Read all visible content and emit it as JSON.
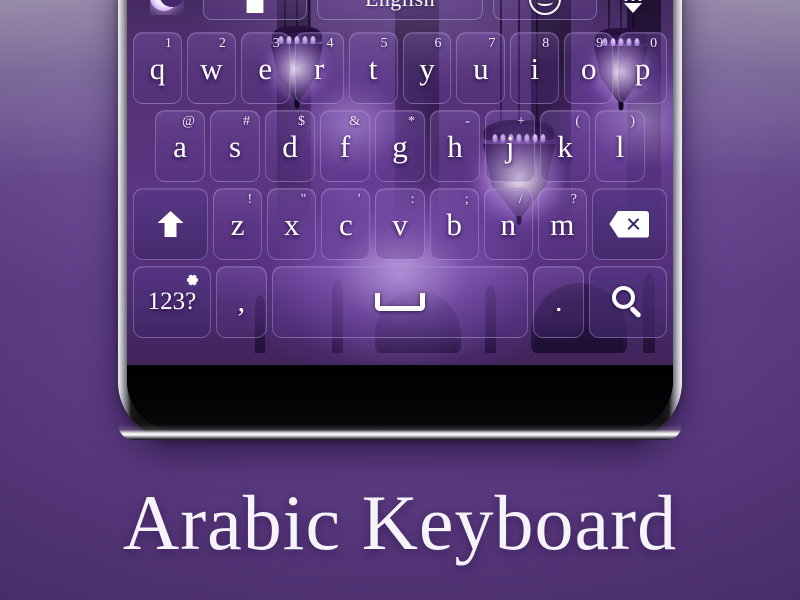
{
  "app": {
    "title": "Arabic Keyboard",
    "theme_colors": {
      "backdrop_purple": "#5e3d85",
      "keyboard_purple": "#563277",
      "key_fill": "#6a4a96",
      "key_border": "#c8b4ee",
      "label_white": "#ffffff",
      "glow_lavender": "#e2c4ff"
    }
  },
  "toolbar": {
    "moon_icon": "crescent-moon-icon",
    "theme_icon": "tshirt-icon",
    "language_label": "English",
    "emoji_icon": "smiley-face-icon",
    "keypad_icon": "keypad-dots-icon"
  },
  "keyboard": {
    "row1": [
      {
        "label": "q",
        "sup": "1"
      },
      {
        "label": "w",
        "sup": "2"
      },
      {
        "label": "e",
        "sup": "3"
      },
      {
        "label": "r",
        "sup": "4"
      },
      {
        "label": "t",
        "sup": "5"
      },
      {
        "label": "y",
        "sup": "6"
      },
      {
        "label": "u",
        "sup": "7"
      },
      {
        "label": "i",
        "sup": "8"
      },
      {
        "label": "o",
        "sup": "9"
      },
      {
        "label": "p",
        "sup": "0"
      }
    ],
    "row2": [
      {
        "label": "a",
        "sup": "@"
      },
      {
        "label": "s",
        "sup": "#"
      },
      {
        "label": "d",
        "sup": "$"
      },
      {
        "label": "f",
        "sup": "&"
      },
      {
        "label": "g",
        "sup": "*"
      },
      {
        "label": "h",
        "sup": "-"
      },
      {
        "label": "j",
        "sup": "+"
      },
      {
        "label": "k",
        "sup": "("
      },
      {
        "label": "l",
        "sup": ")"
      }
    ],
    "row3": [
      {
        "label": "z",
        "sup": "!"
      },
      {
        "label": "x",
        "sup": "\""
      },
      {
        "label": "c",
        "sup": "'"
      },
      {
        "label": "v",
        "sup": ":"
      },
      {
        "label": "b",
        "sup": ";"
      },
      {
        "label": "n",
        "sup": "/"
      },
      {
        "label": "m",
        "sup": "?"
      }
    ],
    "shift_icon": "shift-arrow-icon",
    "backspace_icon": "backspace-icon",
    "row4": {
      "numeric_label": "123?",
      "settings_icon": "gear-icon",
      "comma_label": ",",
      "space_icon": "spacebar-icon",
      "period_label": ".",
      "search_icon": "search-icon"
    }
  }
}
